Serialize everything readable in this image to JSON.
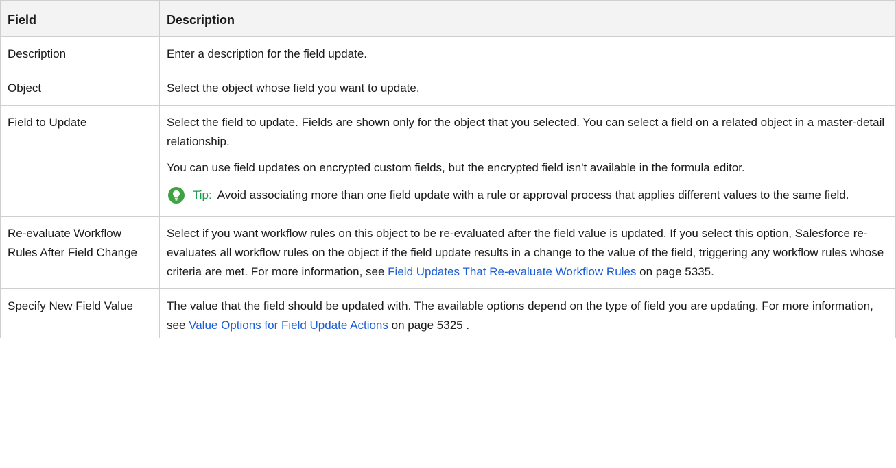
{
  "table": {
    "headers": {
      "field": "Field",
      "description": "Description"
    },
    "rows": {
      "description": {
        "field": "Description",
        "text": "Enter a description for the field update."
      },
      "object": {
        "field": "Object",
        "text": "Select the object whose field you want to update."
      },
      "field_to_update": {
        "field": "Field to Update",
        "para1": "Select the field to update. Fields are shown only for the object that you selected. You can select a field on a related object in a master-detail relationship.",
        "para2": "You can use field updates on encrypted custom fields, but the encrypted field isn't available in the formula editor.",
        "tip_label": "Tip:",
        "tip_text": "Avoid associating more than one field update with a rule or approval process that applies different values to the same field."
      },
      "reevaluate": {
        "field": "Re-evaluate Workflow Rules After Field Change",
        "text_before": "Select if you want workflow rules on this object to be re-evaluated after the field value is updated. If you select this option, Salesforce  re-evaluates all workflow rules on the object if the field update results in a change to the value of the field, triggering any workflow rules whose criteria are met. For more information, see ",
        "link": "Field Updates That Re-evaluate Workflow Rules",
        "text_after": " on page 5335."
      },
      "new_value": {
        "field": "Specify New Field Value",
        "text_before": "The value that the field should be updated with. The available options depend on the type of field you are updating. For more information, see ",
        "link": "Value Options for Field Update Actions",
        "text_after": " on page 5325 ."
      }
    }
  },
  "icons": {
    "tip": "lightbulb-icon"
  },
  "colors": {
    "link": "#1a5dd6",
    "tip_label": "#1a9a4a",
    "tip_icon_bg": "#3fa342",
    "header_bg": "#f3f3f3",
    "border": "#cfcfcf"
  }
}
